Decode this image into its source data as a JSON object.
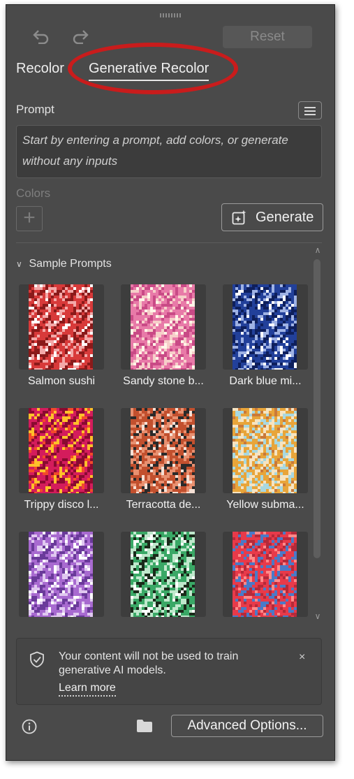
{
  "toolbar": {
    "undo_icon": "undo-icon",
    "redo_icon": "redo-icon",
    "reset_label": "Reset"
  },
  "tabs": {
    "recolor": "Recolor",
    "generative_recolor": "Generative Recolor",
    "active": "Generative Recolor"
  },
  "prompt": {
    "label": "Prompt",
    "placeholder": "Start by entering a prompt, add colors, or generate without any inputs",
    "value": ""
  },
  "colors": {
    "label": "Colors",
    "add_icon": "plus-icon"
  },
  "generate": {
    "label": "Generate",
    "icon": "sparkle-frame-icon"
  },
  "samples": {
    "heading": "Sample Prompts",
    "items": [
      {
        "label": "Salmon sushi",
        "colors": [
          "#d83a3a",
          "#f3a8a8",
          "#8a1a1a",
          "#ffffff"
        ]
      },
      {
        "label": "Sandy stone b...",
        "colors": [
          "#e87aa8",
          "#f6cfc9",
          "#c94a86",
          "#fff5e8"
        ]
      },
      {
        "label": "Dark blue mi...",
        "colors": [
          "#22409a",
          "#9fb2e4",
          "#0e1f5c",
          "#ffffff"
        ]
      },
      {
        "label": "Trippy disco l...",
        "colors": [
          "#d41c5c",
          "#ffc02a",
          "#8a0a30",
          "#f34a2a"
        ]
      },
      {
        "label": "Terracotta de...",
        "colors": [
          "#c2502e",
          "#2a2a2a",
          "#e89070",
          "#f5e0d5"
        ]
      },
      {
        "label": "Yellow subma...",
        "colors": [
          "#e8a53a",
          "#a8d8e0",
          "#f6e4c2",
          "#c9793a"
        ]
      },
      {
        "label": "",
        "colors": [
          "#a86ad0",
          "#e0c8f0",
          "#6a3a9a",
          "#ffffff"
        ]
      },
      {
        "label": "",
        "colors": [
          "#3aa866",
          "#1a2a1a",
          "#bfe8cc",
          "#ffffff"
        ]
      },
      {
        "label": "",
        "colors": [
          "#e83a4a",
          "#b42a3a",
          "#4a7ac8",
          "#ff8a8a"
        ]
      }
    ]
  },
  "notice": {
    "text": "Your content will not be used to train generative AI models.",
    "link": "Learn more",
    "close": "×"
  },
  "footer": {
    "info_icon": "info-icon",
    "folder_icon": "folder-icon",
    "advanced_label": "Advanced Options..."
  },
  "annotation": {
    "highlight_color": "#c91c1c"
  }
}
